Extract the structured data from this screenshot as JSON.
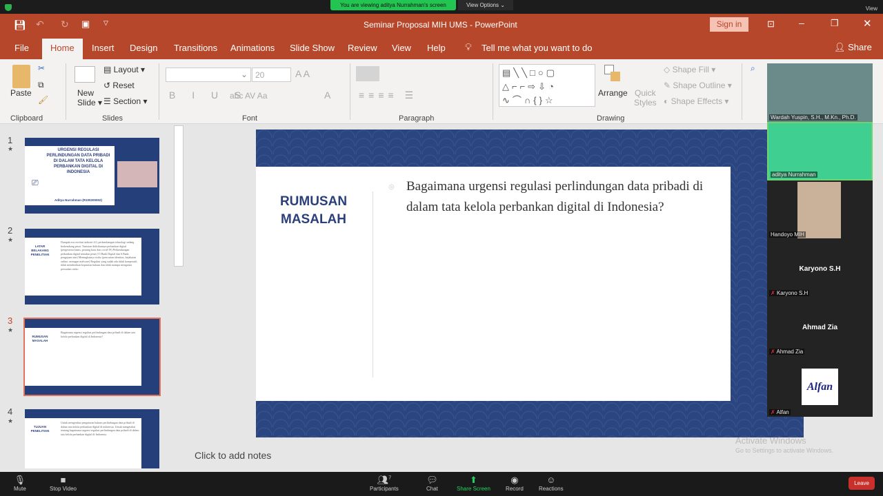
{
  "zoom": {
    "banner": "You are viewing aditya Nurrahman's screen",
    "view_options": "View Options",
    "view": "View",
    "toolbar": {
      "mute": "Mute",
      "stop_video": "Stop Video",
      "participants": "Participants",
      "participants_count": "7",
      "chat": "Chat",
      "share_screen": "Share Screen",
      "record": "Record",
      "reactions": "Reactions",
      "leave": "Leave"
    }
  },
  "app": {
    "title": "Seminar Proposal MIH UMS  -  PowerPoint",
    "sign_in": "Sign in",
    "accent": "#b7472a"
  },
  "tabs": [
    "File",
    "Home",
    "Insert",
    "Design",
    "Transitions",
    "Animations",
    "Slide Show",
    "Review",
    "View",
    "Help"
  ],
  "tell_me": "Tell me what you want to do",
  "share": "Share",
  "ribbon": {
    "paste": "Paste",
    "new_slide": "New",
    "new_slide2": "Slide",
    "layout": "Layout",
    "reset": "Reset",
    "section": "Section",
    "font_size": "20",
    "arrange": "Arrange",
    "quick_styles": "Quick",
    "quick_styles2": "Styles",
    "shape_fill": "Shape Fill",
    "shape_outline": "Shape Outline",
    "shape_effects": "Shape Effects",
    "groups": {
      "clipboard": "Clipboard",
      "slides": "Slides",
      "font": "Font",
      "paragraph": "Paragraph",
      "drawing": "Drawing"
    }
  },
  "thumbnails": [
    {
      "num": "1",
      "title": "URGENSI REGULASI PERLINDUNGAN DATA PRIBADI DI DALAM TATA KELOLA PERBANKAN DIGITAL DI INDONESIA",
      "author": "Aditya Nurrahman (R100200002)"
    },
    {
      "num": "2",
      "title": "LATAR BELAKANG PENELITIAN",
      "body": "Dampak era revolusi industri 4.0, perkembangan teknologi sedang berkembang pesat. Tuntutan didirikannya perbankan digital (pergeseran bisnis, pesaing baru dan covid-19) Perkembangan perbankan digital semakin pesat (15 Bank Digital dan 6 Bank pengajuan izin) Meningkatnya risiko (pencurian identitas, kejahatan online, serangan malware) Regulasi yang sudah ada tidak komperatif, tidak memberikan kepastian hukum dan tidak mampu mengatasi persoalan risiko"
    },
    {
      "num": "3",
      "title": "RUMUSAN MASALAH",
      "body": "Bagaimana urgensi regulasi perlindungan data pribadi di dalam tata kelola perbankan digital di Indonesia?"
    },
    {
      "num": "4",
      "title": "TUJUAN PENELITIAN",
      "body": "Untuk mengetahui pengaturan hukum perlindungan data pribadi di dalam tata kelola perbankan digital di indonesia. Untuk mengetahui tentang bagaimana urgensi regulasi perlindungan data pribadi di dalam tata kelola perbankan digital di Indonesia."
    }
  ],
  "slide": {
    "title": "RUMUSAN MASALAH",
    "body": "Bagaimana urgensi regulasi perlindungan data pribadi di dalam tata kelola perbankan digital di Indonesia?"
  },
  "notes_placeholder": "Click to add notes",
  "participants": [
    {
      "name": "Wardah Yuspin, S.H., M.Kn., Ph.D."
    },
    {
      "name": "aditya Nurrahman"
    },
    {
      "name": "Handoyo MIH"
    },
    {
      "name": "Karyono S.H"
    },
    {
      "name": "Ahmad Zia"
    },
    {
      "name": "Alfan"
    }
  ],
  "watermark": {
    "line1": "Activate Windows",
    "line2": "Go to Settings to activate Windows."
  }
}
